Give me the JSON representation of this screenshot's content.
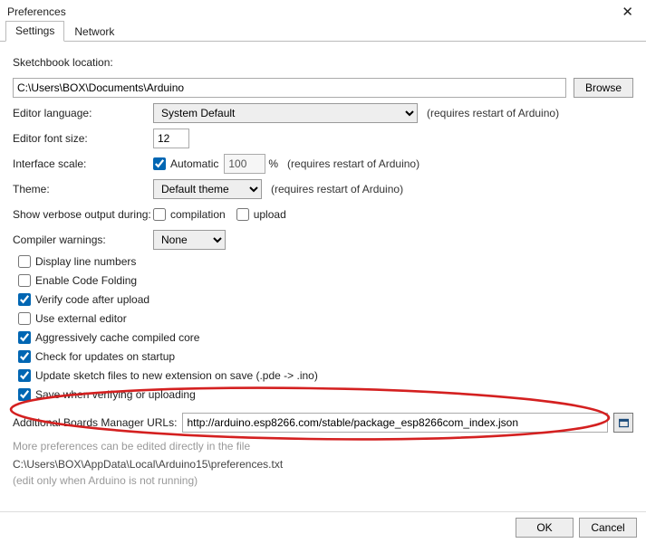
{
  "window": {
    "title": "Preferences"
  },
  "tabs": {
    "settings": "Settings",
    "network": "Network"
  },
  "sketchbook": {
    "label": "Sketchbook location:",
    "path": "C:\\Users\\BOX\\Documents\\Arduino",
    "browse": "Browse"
  },
  "language": {
    "label": "Editor language:",
    "value": "System Default",
    "hint": "(requires restart of Arduino)"
  },
  "fontsize": {
    "label": "Editor font size:",
    "value": "12"
  },
  "scale": {
    "label": "Interface scale:",
    "automatic_label": "Automatic",
    "automatic_checked": true,
    "value": "100",
    "unit": "%",
    "hint": "(requires restart of Arduino)"
  },
  "theme": {
    "label": "Theme:",
    "value": "Default theme",
    "hint": "(requires restart of Arduino)"
  },
  "verbose": {
    "label": "Show verbose output during:",
    "compilation_label": "compilation",
    "compilation_checked": false,
    "upload_label": "upload",
    "upload_checked": false
  },
  "warnings": {
    "label": "Compiler warnings:",
    "value": "None"
  },
  "options": {
    "display_line_numbers": {
      "label": "Display line numbers",
      "checked": false
    },
    "enable_code_folding": {
      "label": "Enable Code Folding",
      "checked": false
    },
    "verify_after_upload": {
      "label": "Verify code after upload",
      "checked": true
    },
    "external_editor": {
      "label": "Use external editor",
      "checked": false
    },
    "cache_compiled_core": {
      "label": "Aggressively cache compiled core",
      "checked": true
    },
    "check_updates": {
      "label": "Check for updates on startup",
      "checked": true
    },
    "update_sketch_ext": {
      "label": "Update sketch files to new extension on save (.pde -> .ino)",
      "checked": true
    },
    "save_on_verify": {
      "label": "Save when verifying or uploading",
      "checked": true
    }
  },
  "boards_url": {
    "label": "Additional Boards Manager URLs:",
    "value": "http://arduino.esp8266.com/stable/package_esp8266com_index.json"
  },
  "footer_notes": {
    "line1": "More preferences can be edited directly in the file",
    "line2": "C:\\Users\\BOX\\AppData\\Local\\Arduino15\\preferences.txt",
    "line3": "(edit only when Arduino is not running)"
  },
  "buttons": {
    "ok": "OK",
    "cancel": "Cancel"
  }
}
